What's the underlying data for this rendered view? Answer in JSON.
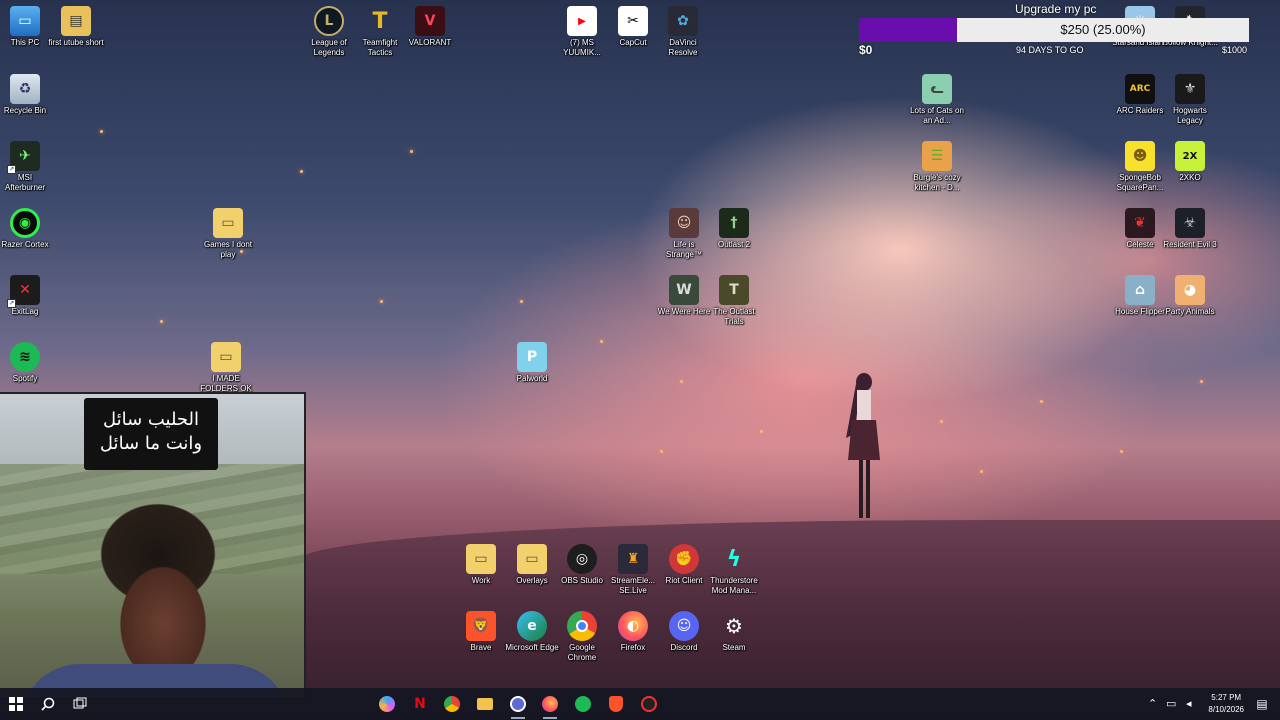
{
  "widget": {
    "title": "Upgrade my pc",
    "progress_text": "$250 (25.00%)",
    "progress_fraction": 0.25,
    "min": "$0",
    "max": "$1000",
    "days": "94 DAYS TO GO",
    "fill_color": "#6a0dad"
  },
  "caption": {
    "line1": "الحليب سائل",
    "line2": "وانت ما سائل"
  },
  "icons": {
    "this_pc": "This PC",
    "first_short": "first utube short",
    "recycle": "Recycle Bin",
    "msi": "MSI Afterburner",
    "razer": "Razer Cortex",
    "games_folder": "Games I dont play",
    "exitlag": "ExitLag",
    "spotify": "Spotify",
    "made_folders": "I MADE FOLDERS OK",
    "lol": "League of Legends",
    "tft": "Teamfight Tactics",
    "valorant": "VALORANT",
    "ms_yuumi": "(7) MS YUUMIK...",
    "capcut": "CapCut",
    "davinci": "DaVinci Resolve",
    "cats": "Lots of Cats on an Ad...",
    "burgie": "Burgie's cozy kitchen - D...",
    "life_strange": "Life is Strange™",
    "outlast2": "Outlast 2",
    "we_were_here": "We Were Here",
    "outlast_trials": "The Outlast Trials",
    "palworld": "Palworld",
    "starsand": "Starsand Island",
    "hollow": "Hollow Knight...",
    "arc": "ARC Raiders",
    "hogwarts": "Hogwarts Legacy",
    "spongebob": "SpongeBob SquarePan...",
    "twoxko": "2XKO",
    "celeste": "Celeste",
    "re3": "Resident Evil 3",
    "house_flipper": "House Flipper",
    "party_animals": "Party Animals",
    "work": "Work",
    "overlays": "Overlays",
    "obs": "OBS Studio",
    "streamelements": "StreamEle... SE.Live",
    "riot": "Riot Client",
    "thunderstore": "Thunderstore Mod Mana...",
    "brave": "Brave",
    "edge": "Microsoft Edge",
    "chrome": "Google Chrome",
    "firefox": "Firefox",
    "discord": "Discord",
    "steam": "Steam"
  },
  "taskbar": {
    "time": "5:27 PM",
    "date": "8/10/2026"
  }
}
